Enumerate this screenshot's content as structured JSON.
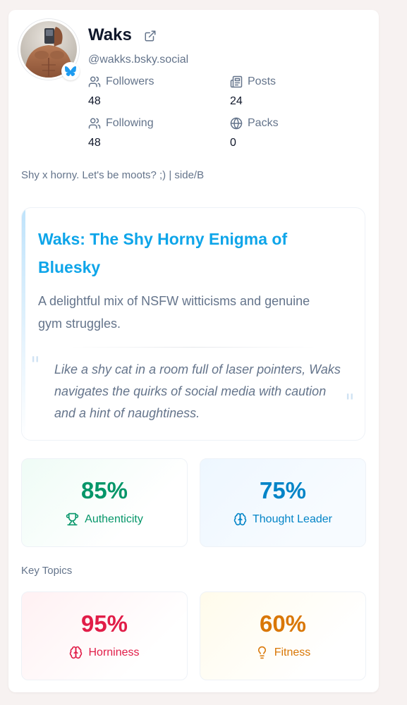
{
  "profile": {
    "name": "Waks",
    "handle": "@wakks.bsky.social",
    "bio": "Shy x horny. Let's be moots? ;) | side/B"
  },
  "stats": {
    "followers_label": "Followers",
    "followers_value": "48",
    "posts_label": "Posts",
    "posts_value": "24",
    "following_label": "Following",
    "following_value": "48",
    "packs_label": "Packs",
    "packs_value": "0"
  },
  "summary": {
    "title": "Waks: The Shy Horny Enigma of Bluesky",
    "description": "A delightful mix of NSFW witticisms and genuine gym struggles.",
    "quote": "Like a shy cat in a room full of laser pointers, Waks navigates the quirks of social media with caution and a hint of naughtiness."
  },
  "metrics": [
    {
      "value": "85%",
      "label": "Authenticity",
      "icon": "trophy-icon",
      "color": "#059669"
    },
    {
      "value": "75%",
      "label": "Thought Leader",
      "icon": "brain-icon",
      "color": "#0284c7"
    }
  ],
  "key_topics": {
    "heading": "Key Topics",
    "items": [
      {
        "value": "95%",
        "label": "Horniness",
        "icon": "brain-icon",
        "color": "#e11d48"
      },
      {
        "value": "60%",
        "label": "Fitness",
        "icon": "lightbulb-icon",
        "color": "#d97706"
      }
    ]
  },
  "colors": {
    "accent": "#0ea5e9",
    "muted_text": "#64748b",
    "bluesky_blue": "#1d9bf0"
  }
}
